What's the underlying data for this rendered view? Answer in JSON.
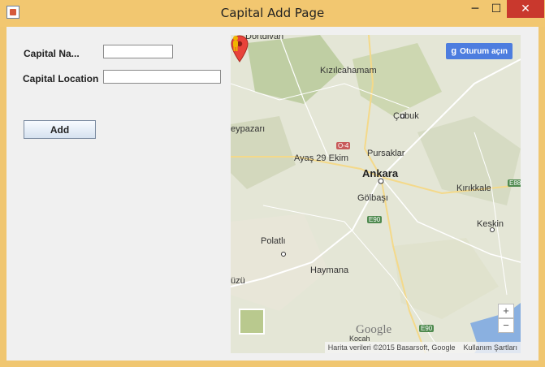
{
  "window": {
    "title": "Capital Add Page",
    "minimize_glyph": "─",
    "maximize_glyph": "☐",
    "close_glyph": "✕",
    "app_icon": "java-icon"
  },
  "form": {
    "capital_name_label": "Capital Na...",
    "capital_name_value": "",
    "capital_location_label": "Capital Location",
    "capital_location_value": "",
    "add_button_label": "Add"
  },
  "map": {
    "signin_label": "Oturum açın",
    "google_g": "g",
    "places": {
      "dortdivan": "Dörtdivan",
      "kizilcahamam": "Kızılcahamam",
      "cubuk": "Çubuk",
      "beypazari": "eypazarı",
      "ayas": "Ayaş 29 Ekim",
      "pursaklar": "Pursaklar",
      "ankara": "Ankara",
      "kirikkale": "Kırıkkale",
      "golbasi": "Gölbaşı",
      "keskin": "Keskin",
      "polatli": "Polatlı",
      "haymana": "Haymana",
      "kozu": "üzü",
      "kocahasan": "Kocah"
    },
    "road_shields": {
      "o4": "O-4",
      "e90_mid": "E90",
      "e88": "E88",
      "e90_bottom": "E90"
    },
    "zoom_in": "+",
    "zoom_out": "−",
    "google_logo": "Google",
    "attribution": "Harita verileri ©2015 Basarsoft, Google",
    "terms": "Kullanım Şartları"
  }
}
